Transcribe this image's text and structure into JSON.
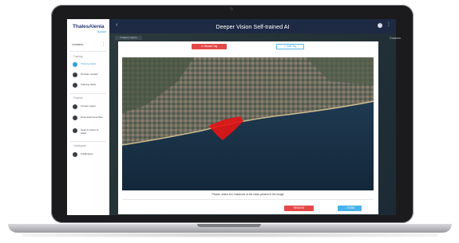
{
  "app": {
    "title": "Deeper Vision Self-trained AI",
    "logo_main": "ThalesAlenia",
    "logo_sub": "Space"
  },
  "user": {
    "name": "Leonardo",
    "menu_icon": "more-vertical-icon"
  },
  "sidebar": {
    "sections": [
      {
        "title": "Training",
        "items": [
          {
            "label": "Training tasks",
            "icon": "brain-icon",
            "active": true
          },
          {
            "label": "Pretrain models",
            "icon": "model-icon",
            "active": false
          },
          {
            "label": "Training tasks",
            "icon": "task-icon",
            "active": false
          }
        ]
      },
      {
        "title": "Projects",
        "items": [
          {
            "label": "Create model",
            "icon": "create-icon",
            "active": false
          },
          {
            "label": "Download input files",
            "icon": "download-icon",
            "active": false
          },
          {
            "label": "Search status of tasks",
            "icon": "search-icon",
            "active": false
          }
        ]
      },
      {
        "title": "Catalogues",
        "items": [
          {
            "label": "Catalogues",
            "icon": "catalogue-icon",
            "active": false
          }
        ]
      }
    ]
  },
  "map": {
    "tab_label": "Imagery Layers",
    "right_label": "Custom"
  },
  "modal": {
    "discard_label": "✕ Discard Tag",
    "add_label": "☐ Add Tag",
    "instruction": "Please, select ALL instances of the class present in the image",
    "remove_label": "REMOVE",
    "done_label": "✓ DONE"
  },
  "colors": {
    "accent": "#2ea0dd",
    "danger": "#e54848",
    "topbar": "#1e2a44",
    "selection": "#e01616"
  }
}
